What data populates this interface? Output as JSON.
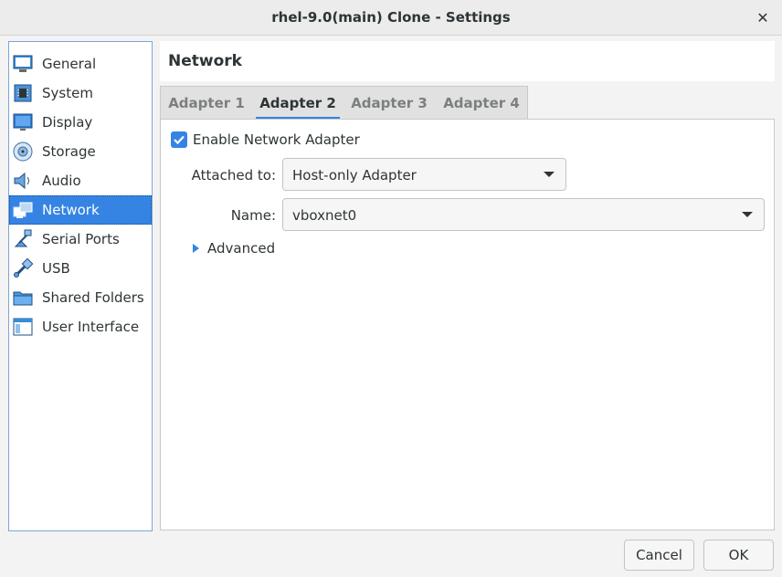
{
  "window": {
    "title": "rhel-9.0(main) Clone - Settings"
  },
  "sidebar": {
    "items": [
      {
        "label": "General",
        "icon": "general-icon"
      },
      {
        "label": "System",
        "icon": "system-icon"
      },
      {
        "label": "Display",
        "icon": "display-icon"
      },
      {
        "label": "Storage",
        "icon": "storage-icon"
      },
      {
        "label": "Audio",
        "icon": "audio-icon"
      },
      {
        "label": "Network",
        "icon": "network-icon",
        "selected": true
      },
      {
        "label": "Serial Ports",
        "icon": "serial-ports-icon"
      },
      {
        "label": "USB",
        "icon": "usb-icon"
      },
      {
        "label": "Shared Folders",
        "icon": "shared-folders-icon"
      },
      {
        "label": "User Interface",
        "icon": "user-interface-icon"
      }
    ]
  },
  "page": {
    "title": "Network"
  },
  "tabs": [
    {
      "label": "Adapter 1"
    },
    {
      "label": "Adapter 2",
      "active": true
    },
    {
      "label": "Adapter 3"
    },
    {
      "label": "Adapter 4"
    }
  ],
  "adapter": {
    "enable_label": "Enable Network Adapter",
    "enabled": true,
    "attached_label": "Attached to:",
    "attached_value": "Host-only Adapter",
    "name_label": "Name:",
    "name_value": "vboxnet0",
    "advanced_label": "Advanced"
  },
  "buttons": {
    "cancel": "Cancel",
    "ok": "OK"
  },
  "colors": {
    "accent": "#3584e4",
    "selection": "#3584e4"
  }
}
